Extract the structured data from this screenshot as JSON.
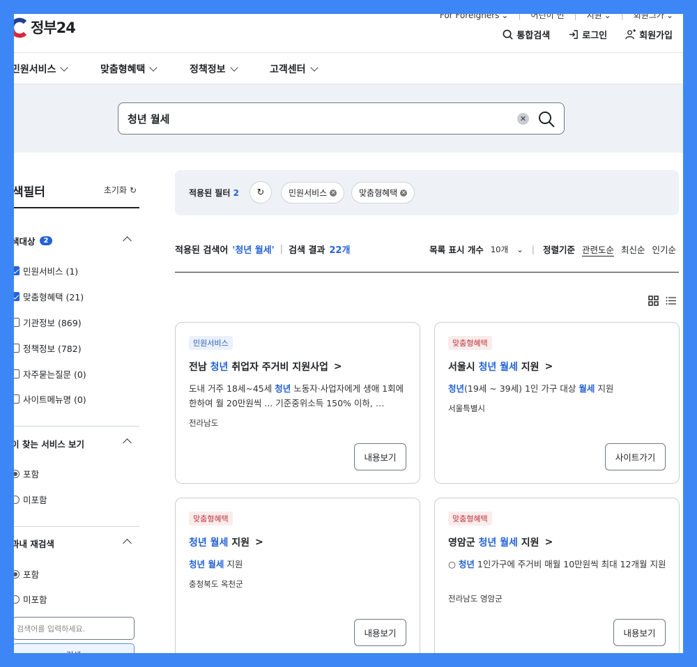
{
  "header": {
    "logo_text": "정부24",
    "util_links": [
      "For Foreigners",
      "어린이 민",
      "지원",
      "회원그가"
    ],
    "actions": {
      "search": "통합검색",
      "login": "로그인",
      "signup": "회원가입"
    }
  },
  "gnb": [
    "민원서비스",
    "맞춤형혜택",
    "정책정보",
    "고객센터"
  ],
  "search": {
    "query": "청년 월세"
  },
  "sidebar": {
    "title": "색필터",
    "reset": "초기화",
    "sections": [
      {
        "title": "색대상",
        "badge": "2",
        "options": [
          {
            "label": "민원서비스 (1)",
            "checked": true
          },
          {
            "label": "맞춤형혜택 (21)",
            "checked": true
          },
          {
            "label": "기관정보 (869)",
            "checked": false
          },
          {
            "label": "정책정보 (782)",
            "checked": false
          },
          {
            "label": "자주묻는질문 (0)",
            "checked": false
          },
          {
            "label": "사이트메뉴명 (0)",
            "checked": false
          }
        ]
      },
      {
        "title": "이 찾는 서비스 보기",
        "options": [
          {
            "label": "포함",
            "checked": true
          },
          {
            "label": "미포함",
            "checked": false
          }
        ]
      },
      {
        "title": "과내 재검색",
        "options": [
          {
            "label": "포함",
            "checked": true
          },
          {
            "label": "미포함",
            "checked": false
          }
        ]
      }
    ],
    "research_placeholder": "검색어를 입력하세요.",
    "research_button": "검색"
  },
  "filters": {
    "label": "적용된 필터",
    "count": "2",
    "chips": [
      "민원서비스",
      "맞춤형혜택"
    ]
  },
  "summary": {
    "applied_label": "적용된 검색어",
    "applied_query": "'청년 월세'",
    "result_label": "검색 결과",
    "result_count": "22개",
    "page_size_label": "목록 표시 개수",
    "page_size": "10개",
    "sort_label": "정렬기준",
    "sort_options": [
      "관련도순",
      "최신순",
      "인기순"
    ]
  },
  "cards": [
    {
      "tag": "민원서비스",
      "title_parts": [
        {
          "text": "전남 ",
          "hl": false
        },
        {
          "text": "청년",
          "hl": true
        },
        {
          "text": " 취업자 주거비 지원사업",
          "hl": false
        }
      ],
      "desc_parts": [
        {
          "text": "도내 거주 18세~45세 ",
          "hl": false
        },
        {
          "text": "청년",
          "hl": true
        },
        {
          "text": " 노동자·사업자에게 생애 1회에 한하여 월 20만원씩 ... 기준중위소득 150% 이하, …",
          "hl": false
        }
      ],
      "region": "전라남도",
      "button": "내용보기"
    },
    {
      "tag": "맞춤형혜택",
      "title_parts": [
        {
          "text": "서울시 ",
          "hl": false
        },
        {
          "text": "청년 월세",
          "hl": true
        },
        {
          "text": " 지원",
          "hl": false
        }
      ],
      "desc_parts": [
        {
          "text": "청년",
          "hl": true
        },
        {
          "text": "(19세 ~ 39세) 1인 가구 대상 ",
          "hl": false
        },
        {
          "text": "월세",
          "hl": true
        },
        {
          "text": " 지원",
          "hl": false
        }
      ],
      "region": "서울특별시",
      "button": "사이트가기"
    },
    {
      "tag": "맞춤형혜택",
      "title_parts": [
        {
          "text": "청년 월세",
          "hl": true
        },
        {
          "text": " 지원",
          "hl": false
        }
      ],
      "desc_parts": [
        {
          "text": "청년 월세",
          "hl": true
        },
        {
          "text": " 지원",
          "hl": false
        }
      ],
      "region": "충청북도 옥천군",
      "button": "내용보기"
    },
    {
      "tag": "맞춤형혜택",
      "title_parts": [
        {
          "text": "영암군 ",
          "hl": false
        },
        {
          "text": "청년 월세",
          "hl": true
        },
        {
          "text": " 지원",
          "hl": false
        }
      ],
      "desc_parts": [
        {
          "text": "○ ",
          "hl": false
        },
        {
          "text": "청년",
          "hl": true
        },
        {
          "text": " 1인가구에 주거비 매월 10만원씩 최대 12개월 지원",
          "hl": false
        }
      ],
      "region": "전라남도 영암군",
      "button": "내용보기"
    }
  ]
}
